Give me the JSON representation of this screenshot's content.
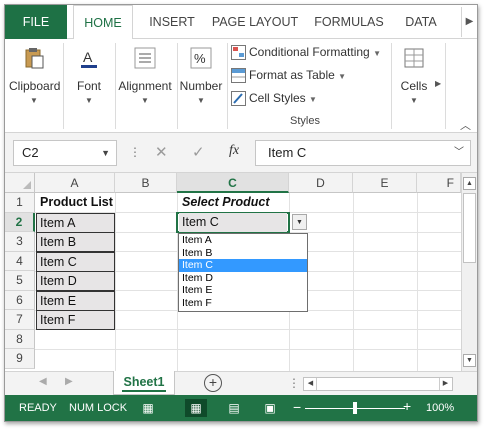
{
  "ribbon_tabs": [
    {
      "label": "FILE"
    },
    {
      "label": "HOME"
    },
    {
      "label": "INSERT"
    },
    {
      "label": "PAGE LAYOUT"
    },
    {
      "label": "FORMULAS"
    },
    {
      "label": "DATA"
    }
  ],
  "ribbon": {
    "clipboard": "Clipboard",
    "font": "Font",
    "alignment": "Alignment",
    "number": "Number",
    "conditional_formatting": "Conditional Formatting",
    "format_as_table": "Format as Table",
    "cell_styles": "Cell Styles",
    "styles_group": "Styles",
    "cells": "Cells"
  },
  "formula_bar": {
    "name_box": "C2",
    "fx": "fx",
    "value": "Item C"
  },
  "columns": [
    "A",
    "B",
    "C",
    "D",
    "E",
    "F"
  ],
  "rows": [
    "1",
    "2",
    "3",
    "4",
    "5",
    "6",
    "7",
    "8",
    "9"
  ],
  "cells": {
    "A1": "Product List",
    "A2": "Item A",
    "A3": "Item B",
    "A4": "Item C",
    "A5": "Item D",
    "A6": "Item E",
    "A7": "Item F",
    "C1": "Select Product",
    "C2": "Item C"
  },
  "dropdown": {
    "options": [
      "Item A",
      "Item B",
      "Item C",
      "Item D",
      "Item E",
      "Item F"
    ],
    "highlighted": "Item C"
  },
  "sheet_tab": "Sheet1",
  "status": {
    "ready": "READY",
    "num_lock": "NUM LOCK",
    "zoom": "100%"
  },
  "colors": {
    "excel_green": "#217346",
    "file_tab": "#1e7145",
    "highlight": "#3399ff",
    "list_fill": "#e7e5e6"
  }
}
